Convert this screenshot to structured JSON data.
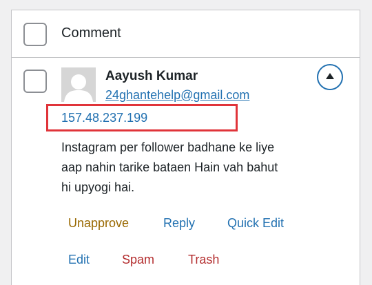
{
  "header": {
    "column_label": "Comment"
  },
  "comment": {
    "author_name": "Aayush Kumar",
    "author_email": "24ghantehelp@gmail.com",
    "author_ip": "157.48.237.199",
    "text_lines": [
      "Instagram per follower badhane ke liye",
      "aap nahin tarike bataen Hain vah bahut",
      "hi upyogi hai."
    ]
  },
  "actions": {
    "unapprove": "Unapprove",
    "reply": "Reply",
    "quick_edit": "Quick Edit",
    "edit": "Edit",
    "spam": "Spam",
    "trash": "Trash"
  },
  "colors": {
    "link": "#2271b1",
    "unapprove": "#996800",
    "danger": "#b32d2e",
    "highlight_box": "#e0343a"
  },
  "icons": {
    "avatar": "default-avatar-icon",
    "toggle": "triangle-up-icon"
  }
}
